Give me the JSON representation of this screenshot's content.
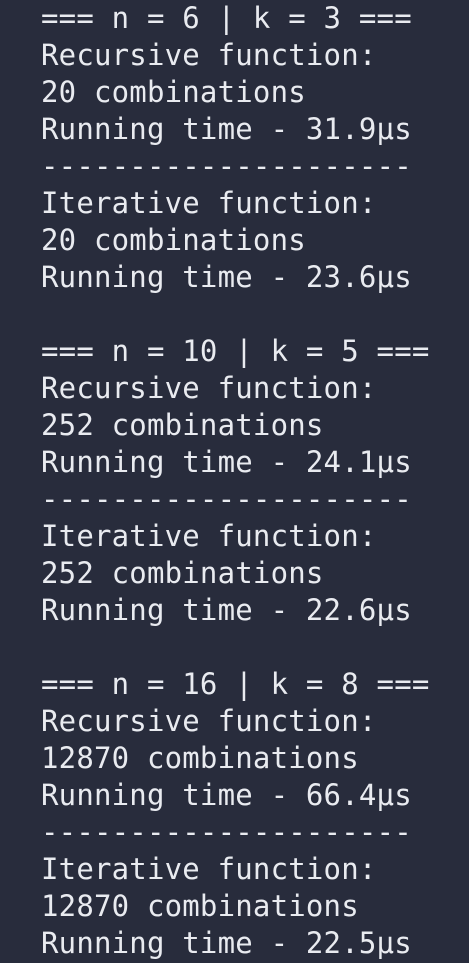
{
  "blocks": [
    {
      "header": "=== n = 6 | k = 3 ===",
      "recursive_label": "Recursive function:",
      "recursive_count": "20 combinations",
      "recursive_time": "Running time - 31.9μs",
      "separator": "---------------------",
      "iterative_label": "Iterative function:",
      "iterative_count": "20 combinations",
      "iterative_time": "Running time - 23.6μs"
    },
    {
      "header": "=== n = 10 | k = 5 ===",
      "recursive_label": "Recursive function:",
      "recursive_count": "252 combinations",
      "recursive_time": "Running time - 24.1μs",
      "separator": "---------------------",
      "iterative_label": "Iterative function:",
      "iterative_count": "252 combinations",
      "iterative_time": "Running time - 22.6μs"
    },
    {
      "header": "=== n = 16 | k = 8 ===",
      "recursive_label": "Recursive function:",
      "recursive_count": "12870 combinations",
      "recursive_time": "Running time - 66.4μs",
      "separator": "---------------------",
      "iterative_label": "Iterative function:",
      "iterative_count": "12870 combinations",
      "iterative_time": "Running time - 22.5μs"
    }
  ]
}
